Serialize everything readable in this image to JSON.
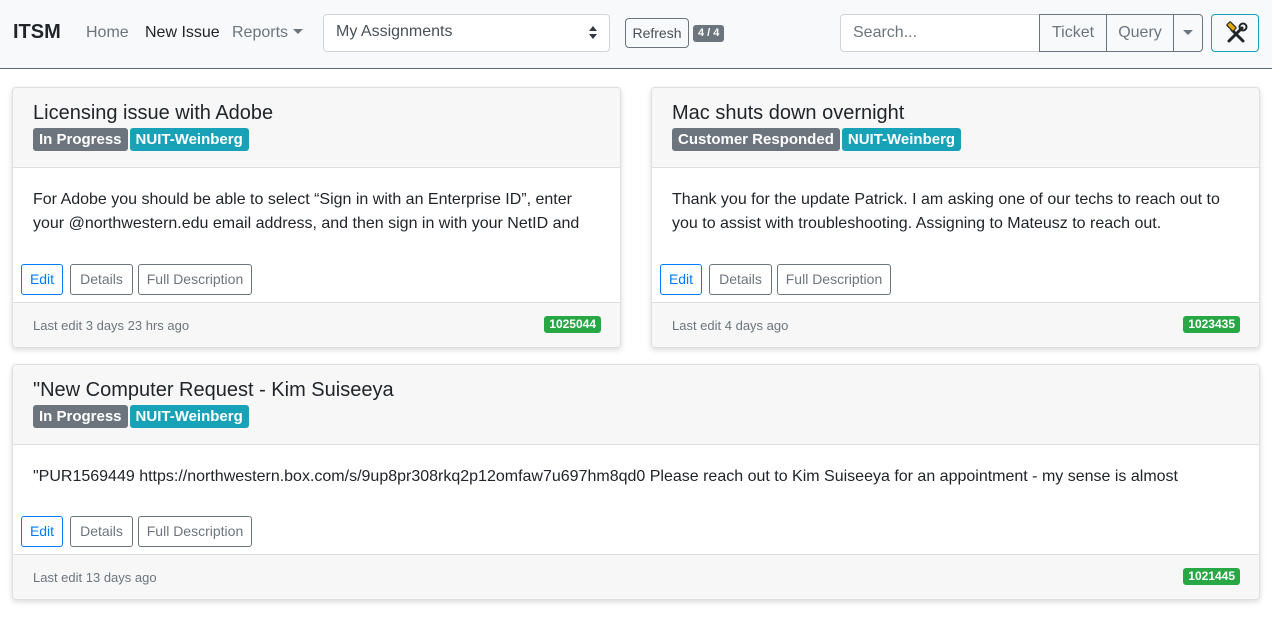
{
  "navbar": {
    "brand": "ITSM",
    "home": "Home",
    "new_issue": "New Issue",
    "reports": "Reports",
    "view_select": "My Assignments",
    "refresh": "Refresh",
    "count": "4 / 4",
    "search_placeholder": "Search...",
    "ticket": "Ticket",
    "query": "Query",
    "tools_icon": "hammer-wrench-icon"
  },
  "cards": [
    {
      "title": "Licensing issue with Adobe",
      "status": "In Progress",
      "group": "NUIT-Weinberg",
      "body_line1": "For Adobe you should be able to select “Sign in with an Enterprise ID”, enter",
      "body_line2": "your @northwestern.edu email address, and then sign in with your NetID and",
      "edit": "Edit",
      "details": "Details",
      "full_description": "Full Description",
      "last_edit": "Last edit 3 days 23 hrs ago",
      "ticket_number": "1025044"
    },
    {
      "title": "Mac shuts down overnight",
      "status": "Customer Responded",
      "group": "NUIT-Weinberg",
      "body_line1": "Thank you for the update Patrick. I am asking one of our techs to reach out to",
      "body_line2": "you to assist with troubleshooting. Assigning to Mateusz to reach out.",
      "edit": "Edit",
      "details": "Details",
      "full_description": "Full Description",
      "last_edit": "Last edit 4 days ago",
      "ticket_number": "1023435"
    },
    {
      "title": "\"New Computer Request - Kim Suiseeya",
      "status": "In Progress",
      "group": "NUIT-Weinberg",
      "body_line1": "\"PUR1569449 https://northwestern.box.com/s/9up8pr308rkq2p12omfaw7u697hm8qd0 Please reach out to Kim Suiseeya for an appointment - my sense is almost",
      "edit": "Edit",
      "details": "Details",
      "full_description": "Full Description",
      "last_edit": "Last edit 13 days ago",
      "ticket_number": "1021445"
    }
  ],
  "colors": {
    "status_badge": "#6c757d",
    "group_badge": "#17a2b8",
    "ticket_badge": "#28a745",
    "edit_button": "#007bff"
  }
}
